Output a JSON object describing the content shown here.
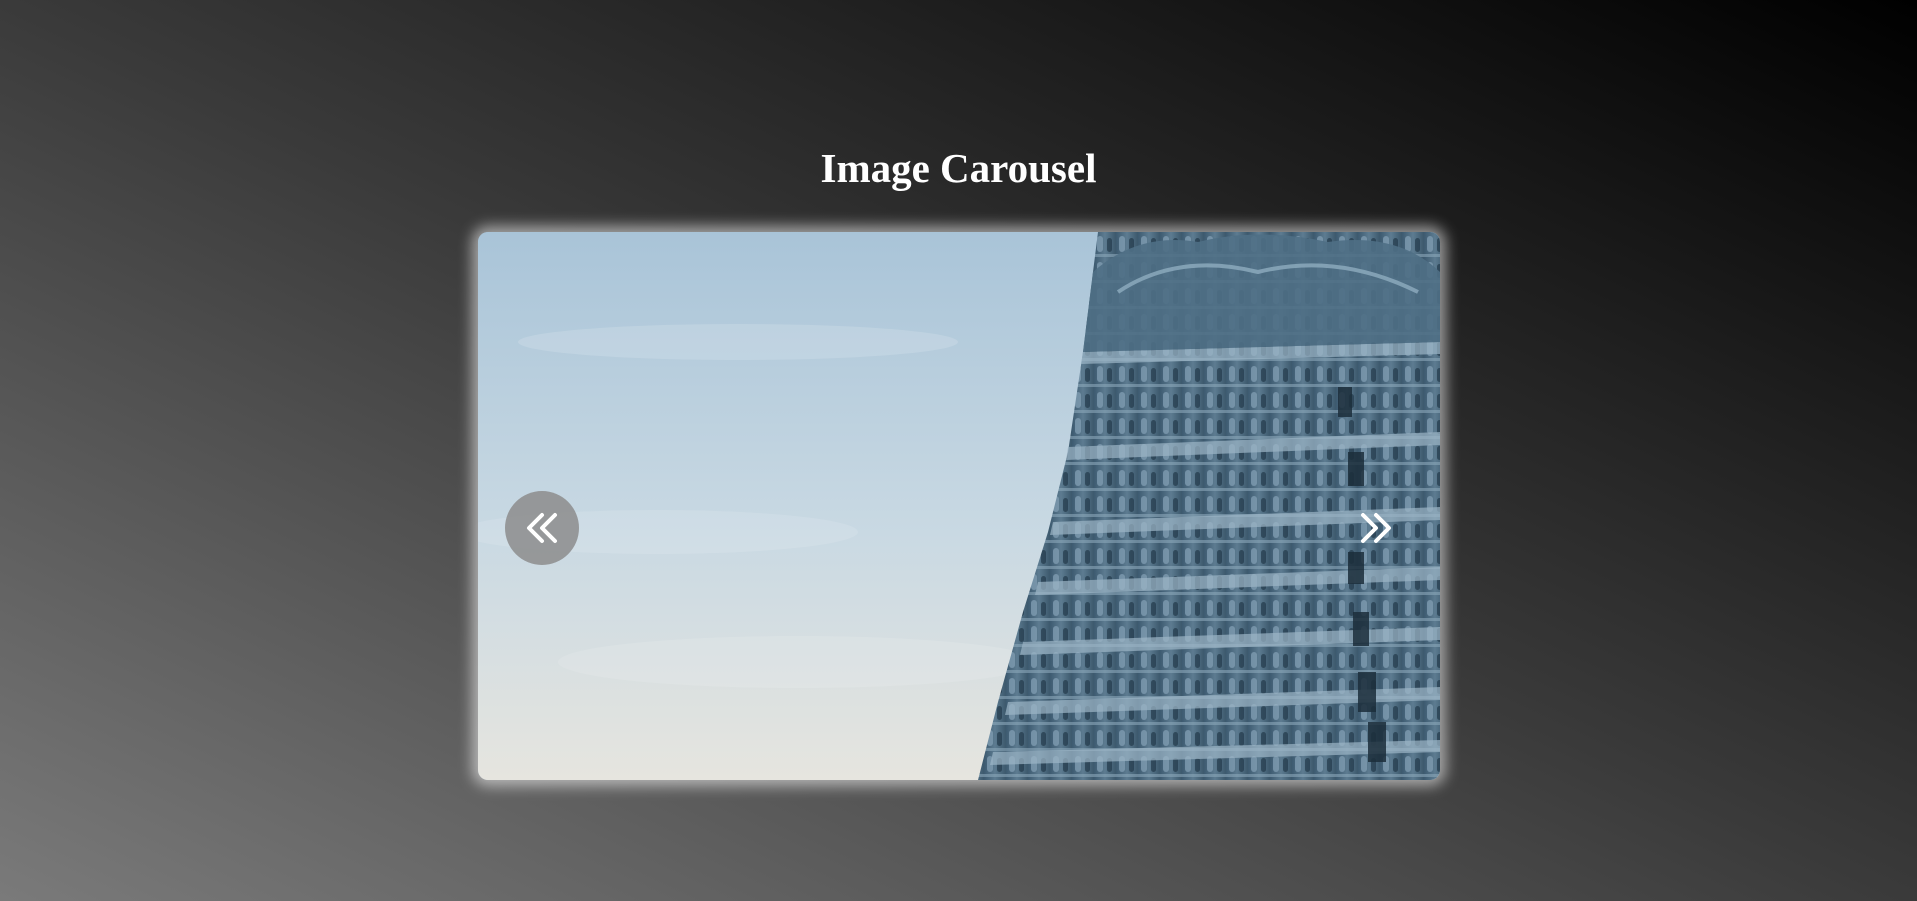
{
  "page": {
    "title": "Image Carousel"
  },
  "carousel": {
    "slide_image": "temple-gopuram-photo",
    "prev_icon": "double-chevron-left-icon",
    "next_icon": "double-chevron-right-icon"
  },
  "colors": {
    "background_start": "#7a7a7a",
    "background_end": "#000000",
    "title": "#ffffff",
    "prev_button_bg": "#8c8c8c",
    "sky": "#b9cfdf",
    "temple": "#4d6a80"
  }
}
